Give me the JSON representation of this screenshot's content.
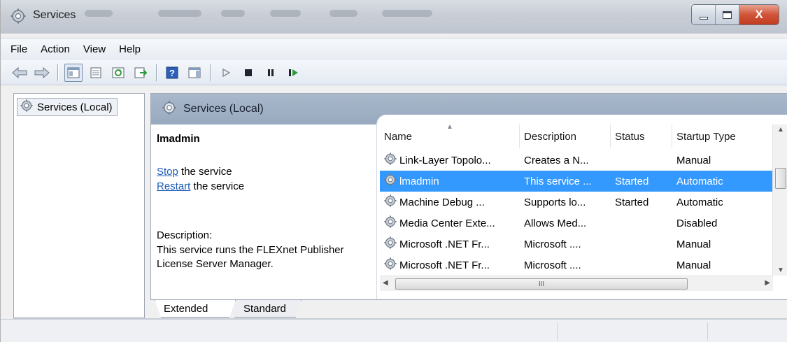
{
  "window": {
    "title": "Services",
    "controls": {
      "minimize": "minimize",
      "maximize": "maximize",
      "close": "X"
    }
  },
  "menu": [
    "File",
    "Action",
    "View",
    "Help"
  ],
  "toolbar": {
    "buttons": [
      "back-arrow-icon",
      "forward-arrow-icon",
      "show-hide-console-tree-icon",
      "properties-icon",
      "refresh-icon",
      "export-list-icon",
      "help-icon",
      "show-action-pane-icon",
      "start-service-icon",
      "stop-service-icon",
      "pause-service-icon",
      "resume-service-icon"
    ]
  },
  "tree": {
    "root_label": "Services (Local)"
  },
  "content": {
    "header_label": "Services (Local)",
    "selected_service": "lmadmin",
    "actions": [
      {
        "link": "Stop",
        "suffix": " the service"
      },
      {
        "link": "Restart",
        "suffix": " the service"
      }
    ],
    "description_label": "Description:",
    "description_text": "This service runs the FLEXnet Publisher License Server Manager."
  },
  "table": {
    "columns": [
      "Name",
      "Description",
      "Status",
      "Startup Type"
    ],
    "rows": [
      {
        "name": "Link-Layer Topolo...",
        "description": "Creates a N...",
        "status": "",
        "startup": "Manual",
        "selected": false
      },
      {
        "name": "lmadmin",
        "description": "This service ...",
        "status": "Started",
        "startup": "Automatic",
        "selected": true
      },
      {
        "name": "Machine Debug ...",
        "description": "Supports lo...",
        "status": "Started",
        "startup": "Automatic",
        "selected": false
      },
      {
        "name": "Media Center Exte...",
        "description": "Allows Med...",
        "status": "",
        "startup": "Disabled",
        "selected": false
      },
      {
        "name": "Microsoft .NET Fr...",
        "description": "Microsoft ....",
        "status": "",
        "startup": "Manual",
        "selected": false
      },
      {
        "name": "Microsoft .NET Fr...",
        "description": "Microsoft ....",
        "status": "",
        "startup": "Manual",
        "selected": false
      }
    ],
    "hscroll_thumb_label": "III"
  },
  "tabs": {
    "active": "Extended",
    "inactive": "Standard"
  },
  "colors": {
    "selection": "#3399ff",
    "link": "#1a5bb8",
    "header_band": "#a9b8cb"
  }
}
